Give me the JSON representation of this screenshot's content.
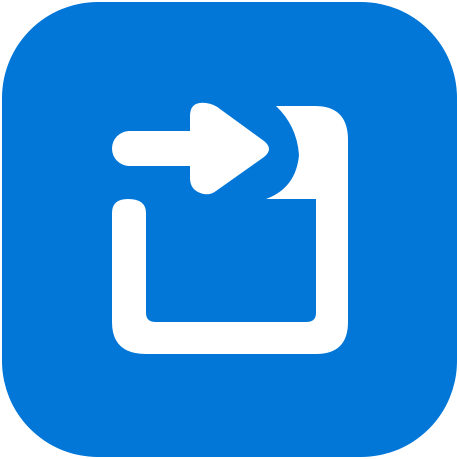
{
  "icon": {
    "name": "share-export-app-icon",
    "glyph": "arrow-into-square-icon"
  },
  "colors": {
    "tile": "#0277d8",
    "glyph": "#ffffff",
    "page_background": "#ffffff"
  }
}
